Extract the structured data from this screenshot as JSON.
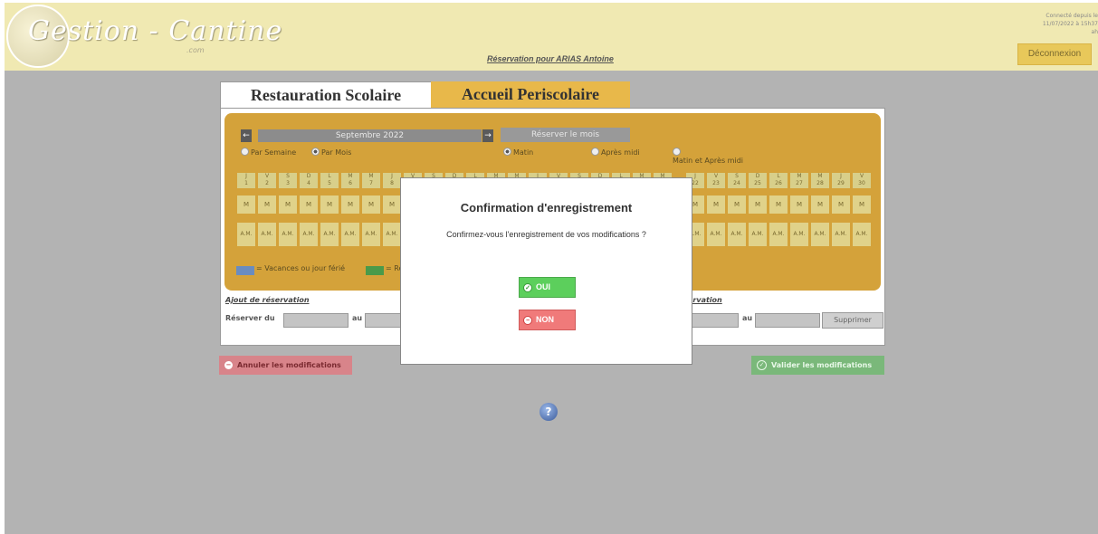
{
  "header": {
    "logo_text": "Gestion - Cantine",
    "logo_sub": ".com",
    "reservation_title": "Réservation pour ARIAS Antoine",
    "connected_text": "Connecté depuis le 11/07/2022 à 15h37",
    "connected_extra": "ah",
    "logout_label": "Déconnexion"
  },
  "tabs": [
    {
      "label": "Restauration Scolaire"
    },
    {
      "label": "Accueil Periscolaire"
    }
  ],
  "calendar": {
    "prev_icon": "←",
    "next_icon": "→",
    "month": "Septembre 2022",
    "reserve_month_label": "Réserver le mois",
    "view_options": [
      {
        "label": "Par Semaine",
        "selected": false
      },
      {
        "label": "Par Mois",
        "selected": true
      }
    ],
    "slot_options": [
      {
        "label": "Matin",
        "selected": true
      },
      {
        "label": "Après midi",
        "selected": false
      },
      {
        "label": "Matin et Après midi",
        "selected": false
      }
    ],
    "days_left": [
      {
        "letter": "J",
        "num": "1"
      },
      {
        "letter": "V",
        "num": "2"
      },
      {
        "letter": "S",
        "num": "3"
      },
      {
        "letter": "D",
        "num": "4"
      },
      {
        "letter": "L",
        "num": "5"
      },
      {
        "letter": "M",
        "num": "6"
      },
      {
        "letter": "M",
        "num": "7"
      },
      {
        "letter": "J",
        "num": "8"
      },
      {
        "letter": "V",
        "num": ""
      },
      {
        "letter": "S",
        "num": ""
      },
      {
        "letter": "D",
        "num": ""
      },
      {
        "letter": "L",
        "num": ""
      },
      {
        "letter": "M",
        "num": ""
      },
      {
        "letter": "M",
        "num": ""
      },
      {
        "letter": "J",
        "num": ""
      },
      {
        "letter": "V",
        "num": ""
      },
      {
        "letter": "S",
        "num": ""
      },
      {
        "letter": "D",
        "num": ""
      },
      {
        "letter": "L",
        "num": ""
      },
      {
        "letter": "M",
        "num": ""
      },
      {
        "letter": "M",
        "num": ""
      }
    ],
    "days_right": [
      {
        "letter": "J",
        "num": "22"
      },
      {
        "letter": "V",
        "num": "23"
      },
      {
        "letter": "S",
        "num": "24"
      },
      {
        "letter": "D",
        "num": "25"
      },
      {
        "letter": "L",
        "num": "26"
      },
      {
        "letter": "M",
        "num": "27"
      },
      {
        "letter": "M",
        "num": "28"
      },
      {
        "letter": "J",
        "num": "29"
      },
      {
        "letter": "V",
        "num": "30"
      }
    ],
    "morning_slot": "M",
    "afternoon_slot": "A.M.",
    "legend": [
      {
        "label": "= Vacances ou jour férié",
        "color": "#6a8cc0"
      },
      {
        "label": "= Ré",
        "color": "#4a9a4a"
      }
    ]
  },
  "reservation": {
    "add_title": "Ajout de réservation",
    "reserve_from_label": "Réserver du",
    "to_label": "au",
    "remove_title_fragment": "ervation",
    "remove_to_label": "au",
    "remove_button": "Supprimer"
  },
  "actions": {
    "cancel_label": "Annuler les modifications",
    "validate_label": "Valider les modifications",
    "help_label": "?"
  },
  "modal": {
    "title": "Confirmation d'enregistrement",
    "message": "Confirmez-vous l'enregistrement de vos modifications ?",
    "yes_label": "OUI",
    "no_label": "NON"
  },
  "colors": {
    "header_bg": "#f0e9b2",
    "overlay": "#b3b3b3",
    "calendar_bg": "#d4a23a",
    "yes": "#5ccf5c",
    "no": "#f07a7a"
  }
}
